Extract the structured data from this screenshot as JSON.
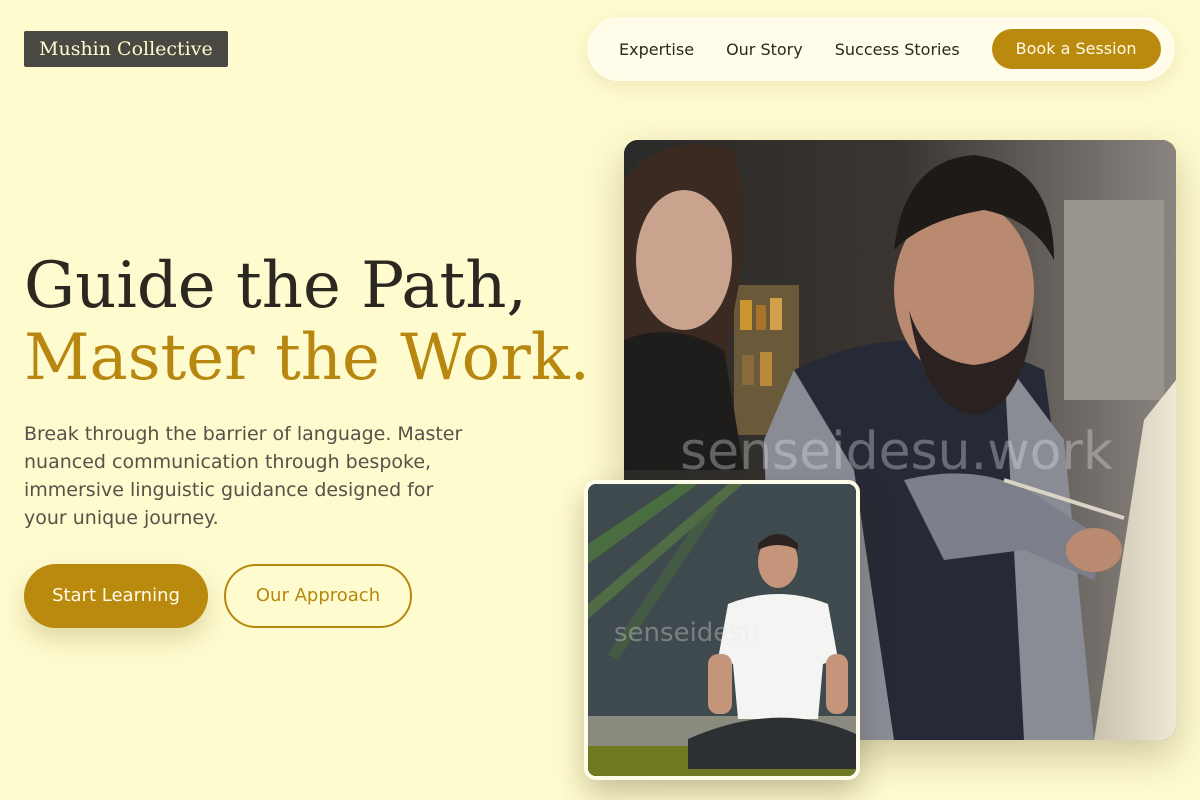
{
  "brand": {
    "name": "Mushin Collective"
  },
  "nav": {
    "links": [
      "Expertise",
      "Our Story",
      "Success Stories"
    ],
    "cta": "Book a Session"
  },
  "hero": {
    "headline_line1": "Guide the Path,",
    "headline_line2": "Master the Work.",
    "description": "Break through the barrier of language. Master nuanced communication through bespoke, immersive linguistic guidance designed for your unique journey.",
    "primary_button": "Start Learning",
    "secondary_button": "Our Approach"
  },
  "images": {
    "main_watermark": "senseidesu.work",
    "inset_watermark": "senseidesu"
  },
  "colors": {
    "background": "#fefbcf",
    "accent": "#ba8a0f",
    "logo_bg": "#4a4843",
    "text_dark": "#2a2820"
  }
}
